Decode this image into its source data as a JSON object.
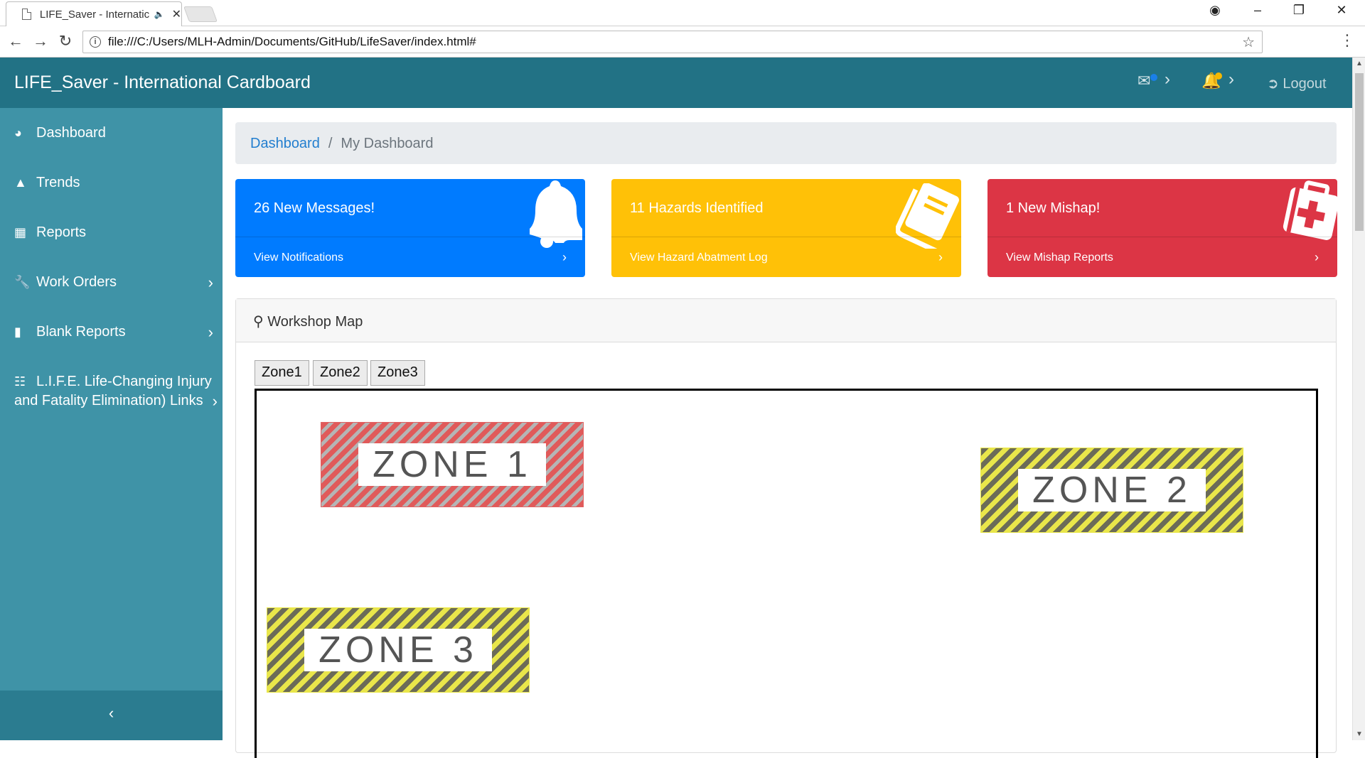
{
  "browser": {
    "tab_title": "LIFE_Saver - Internatic",
    "url": "file:///C:/Users/MLH-Admin/Documents/GitHub/LifeSaver/index.html#"
  },
  "navbar": {
    "brand": "LIFE_Saver - International Cardboard",
    "logout_label": "Logout",
    "mail_dot_color": "#1a7fe8",
    "bell_dot_color": "#f5b800"
  },
  "sidebar": {
    "items": [
      {
        "label": "Dashboard",
        "icon": "dashboard-icon"
      },
      {
        "label": "Trends",
        "icon": "area-chart-icon"
      },
      {
        "label": "Reports",
        "icon": "table-icon"
      },
      {
        "label": "Work Orders",
        "icon": "wrench-icon"
      },
      {
        "label": "Blank Reports",
        "icon": "file-icon"
      },
      {
        "label_line1": "L.I.F.E. Life-Changing Injury",
        "label_line2": "and Fatality Elimination) Links",
        "icon": "sitemap-icon"
      }
    ],
    "collapse_icon": "chevron-left-icon"
  },
  "breadcrumb": {
    "link": "Dashboard",
    "current": "My Dashboard"
  },
  "cards": [
    {
      "title": "26 New Messages!",
      "footer": "View Notifications",
      "color": "#007bff",
      "icon": "bell-icon"
    },
    {
      "title": "11 Hazards Identified",
      "footer": "View Hazard Abatment Log",
      "color": "#ffc107",
      "icon": "book-icon"
    },
    {
      "title": "1 New Mishap!",
      "footer": "View Mishap Reports",
      "color": "#dc3545",
      "icon": "medkit-icon"
    }
  ],
  "map": {
    "title": "Workshop Map",
    "tabs": [
      "Zone1",
      "Zone2",
      "Zone3"
    ],
    "zones": [
      {
        "label": "ZONE 1",
        "color": "#e05a5a"
      },
      {
        "label": "ZONE 2",
        "color": "#e9e64a"
      },
      {
        "label": "ZONE 3",
        "color": "#e9e64a"
      }
    ]
  }
}
